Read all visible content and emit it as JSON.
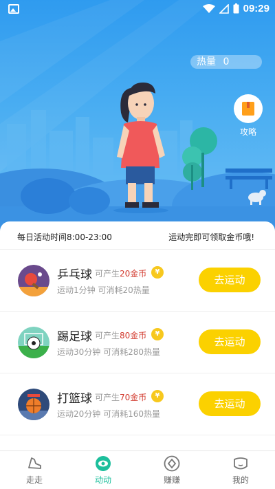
{
  "status_bar": {
    "time": "09:29"
  },
  "hero": {
    "heat_label": "热量",
    "heat_value": "0",
    "guide_label": "攻略"
  },
  "info": {
    "left": "每日活动时间8:00-23:00",
    "right": "运动完即可领取金币哦!"
  },
  "activities": [
    {
      "name": "乒乓球",
      "earn_prefix": "可产生",
      "coins": "20金币",
      "coin_symbol": "¥",
      "desc": "运动1分钟 可消耗20热量",
      "button": "去运动"
    },
    {
      "name": "踢足球",
      "earn_prefix": "可产生",
      "coins": "80金币",
      "coin_symbol": "¥",
      "desc": "运动30分钟 可消耗280热量",
      "button": "去运动"
    },
    {
      "name": "打篮球",
      "earn_prefix": "可产生",
      "coins": "70金币",
      "coin_symbol": "¥",
      "desc": "运动20分钟 可消耗160热量",
      "button": "去运动"
    }
  ],
  "nav": [
    {
      "label": "走走",
      "icon": "shoe-icon",
      "active": false
    },
    {
      "label": "动动",
      "icon": "eye-icon",
      "active": true
    },
    {
      "label": "赚赚",
      "icon": "diamond-icon",
      "active": false
    },
    {
      "label": "我的",
      "icon": "face-icon",
      "active": false
    }
  ],
  "colors": {
    "accent": "#1cbf9c",
    "button": "#fbd100",
    "coin_text": "#d23a2e",
    "sky": "#2f9bef"
  }
}
